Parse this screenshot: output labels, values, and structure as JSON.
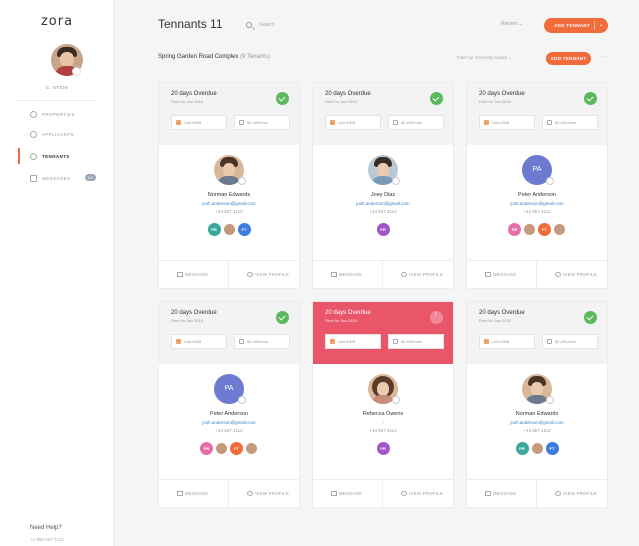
{
  "app": {
    "logo": "zora"
  },
  "sidebar": {
    "username": "C. STEIN",
    "items": [
      {
        "label": "PROPERTIES",
        "active": false
      },
      {
        "label": "APPLICANTS",
        "active": false
      },
      {
        "label": "TENNANTS",
        "active": true
      },
      {
        "label": "MESSAGES",
        "active": false,
        "badge": "14"
      }
    ],
    "help_title": "Need Help?",
    "help_phone": "+1 888 567 7412"
  },
  "header": {
    "title": "Tennants 11",
    "search_placeholder": "Search",
    "sort_label": "Recent  ⌄",
    "add_button": "ADD TENNANT",
    "add_caret": "⌄"
  },
  "subheader": {
    "complex_name": "Spring Garden Road Complex",
    "complex_count": "(9 Tenants)",
    "filter": "Filter by: Recently Added  ⌄",
    "add_button": "ADD TENNANT",
    "more": "···"
  },
  "colors": {
    "accent": "#f26b3a",
    "overdue_red": "#e9566a",
    "ok_green": "#5cb85c",
    "link": "#3b82c4"
  },
  "cards": [
    {
      "status": "20 days Overdue",
      "rent_for": "Rent for Jan 2016",
      "unit": "Unit #308",
      "rent": "$2,400/mon",
      "name": "Norman Edwards",
      "email": "josh.anderson@gmail.com",
      "phone": "+44 657 4112",
      "co_tenants": [
        {
          "initials": "PR",
          "color": "#3aa89a"
        },
        {
          "initials": "",
          "color": "photo"
        },
        {
          "initials": "FT",
          "color": "#3d7be0"
        }
      ],
      "message": "MESSAGE",
      "view": "VIEW PROFILE"
    },
    {
      "status": "20 days Overdue",
      "rent_for": "Rent for Jan 2016",
      "unit": "Unit #308",
      "rent": "$2,400/mon",
      "name": "Joey Diaz",
      "email": "josh.anderson@gmail.com",
      "phone": "+44 657 4112",
      "co_tenants": [
        {
          "initials": "PR",
          "color": "#a056c8"
        }
      ],
      "message": "MESSAGE",
      "view": "VIEW PROFILE"
    },
    {
      "status": "20 days Overdue",
      "rent_for": "Rent for Jan 2016",
      "unit": "Unit #308",
      "rent": "$2,400/mon",
      "name": "Peter Anderson",
      "email": "josh.anderson@gmail.com",
      "phone": "+44 657 4112",
      "initials": "PA",
      "co_tenants": [
        {
          "initials": "PR",
          "color": "#e86ea8"
        },
        {
          "initials": "",
          "color": "photo"
        },
        {
          "initials": "FT",
          "color": "#f26b3a"
        },
        {
          "initials": "",
          "color": "photo"
        }
      ],
      "message": "MESSAGE",
      "view": "VIEW PROFILE"
    },
    {
      "status": "20 days Overdue",
      "rent_for": "Rent for Jan 2016",
      "unit": "Unit #308",
      "rent": "$2,400/mon",
      "name": "Peter Anderson",
      "email": "josh.anderson@gmail.com",
      "phone": "+44 657 4112",
      "initials": "PA",
      "co_tenants": [
        {
          "initials": "PR",
          "color": "#e86ea8"
        },
        {
          "initials": "",
          "color": "photo"
        },
        {
          "initials": "FT",
          "color": "#f26b3a"
        },
        {
          "initials": "",
          "color": "photo"
        }
      ],
      "message": "MESSAGE",
      "view": "VIEW PROFILE"
    },
    {
      "status": "20 days Overdue",
      "rent_for": "Rent for Jan 2016",
      "unit": "Unit #308",
      "rent": "$2,400/mon",
      "name": "Rebecca Owens",
      "email": "✓",
      "phone": "+44 657 4112",
      "co_tenants": [
        {
          "initials": "PR",
          "color": "#a056c8"
        }
      ],
      "message": "MESSAGE",
      "view": "VIEW PROFILE"
    },
    {
      "status": "20 days Overdue",
      "rent_for": "Rent for Jan 2016",
      "unit": "Unit #308",
      "rent": "$2,400/mon",
      "name": "Norman Edwards",
      "email": "josh.anderson@gmail.com",
      "phone": "+44 657 4112",
      "co_tenants": [
        {
          "initials": "PR",
          "color": "#3aa89a"
        },
        {
          "initials": "",
          "color": "photo"
        },
        {
          "initials": "FT",
          "color": "#3d7be0"
        }
      ],
      "message": "MESSAGE",
      "view": "VIEW PROFILE"
    }
  ]
}
